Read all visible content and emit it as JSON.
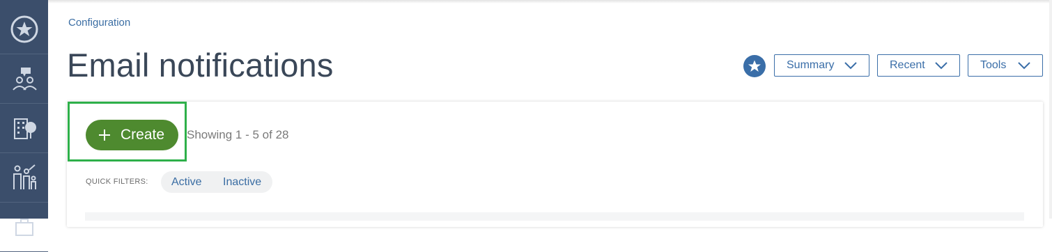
{
  "nav_rail": {
    "items": [
      {
        "name": "favorites-icon"
      },
      {
        "name": "people-chat-icon"
      },
      {
        "name": "building-tree-icon"
      },
      {
        "name": "family-icon"
      },
      {
        "name": "briefcase-icon"
      }
    ]
  },
  "breadcrumb": "Configuration",
  "page_title": "Email notifications",
  "header_actions": {
    "favorite_icon": "star-icon",
    "summary_label": "Summary",
    "recent_label": "Recent",
    "tools_label": "Tools"
  },
  "toolbar": {
    "create_label": "Create",
    "showing_text": "Showing 1 - 5 of 28"
  },
  "quick_filters": {
    "label": "QUICK FILTERS:",
    "items": [
      "Active",
      "Inactive"
    ]
  },
  "colors": {
    "rail": "#3b4e6b",
    "accent": "#3a6ea8",
    "create": "#4e8a2f",
    "highlight": "#2eb04a"
  }
}
